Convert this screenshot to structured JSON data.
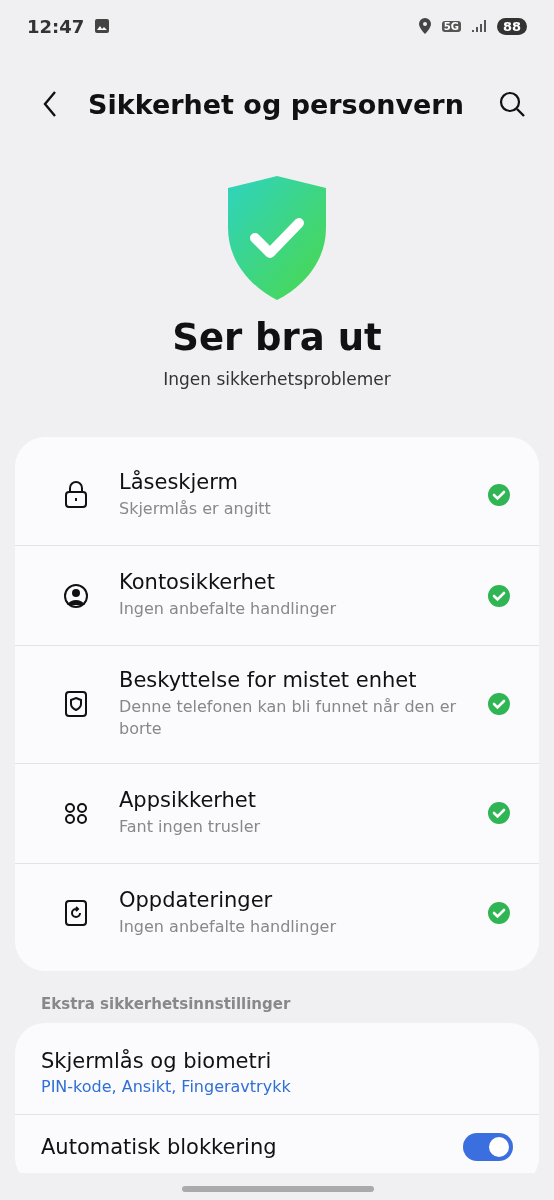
{
  "status_bar": {
    "time": "12:47",
    "battery": "88",
    "network": "5G"
  },
  "header": {
    "title": "Sikkerhet og personvern"
  },
  "summary": {
    "ok": true,
    "title": "Ser bra ut",
    "subtitle": "Ingen sikkerhetsproblemer"
  },
  "checks": [
    {
      "kind": "lock",
      "title": "Låseskjerm",
      "subtitle": "Skjermlås er angitt",
      "ok": true
    },
    {
      "kind": "account",
      "title": "Kontosikkerhet",
      "subtitle": "Ingen anbefalte handlinger",
      "ok": true
    },
    {
      "kind": "device",
      "title": "Beskyttelse for mistet enhet",
      "subtitle": "Denne telefonen kan bli funnet når den er borte",
      "ok": true
    },
    {
      "kind": "apps",
      "title": "Appsikkerhet",
      "subtitle": "Fant ingen trusler",
      "ok": true
    },
    {
      "kind": "update",
      "title": "Oppdateringer",
      "subtitle": "Ingen anbefalte handlinger",
      "ok": true
    }
  ],
  "extra": {
    "heading": "Ekstra sikkerhetsinnstillinger",
    "items": [
      {
        "kind": "link",
        "title": "Skjermlås og biometri",
        "subtitle": "PIN-kode, Ansikt, Fingeravtrykk"
      },
      {
        "kind": "switch",
        "title": "Automatisk blokkering",
        "on": true
      }
    ]
  }
}
